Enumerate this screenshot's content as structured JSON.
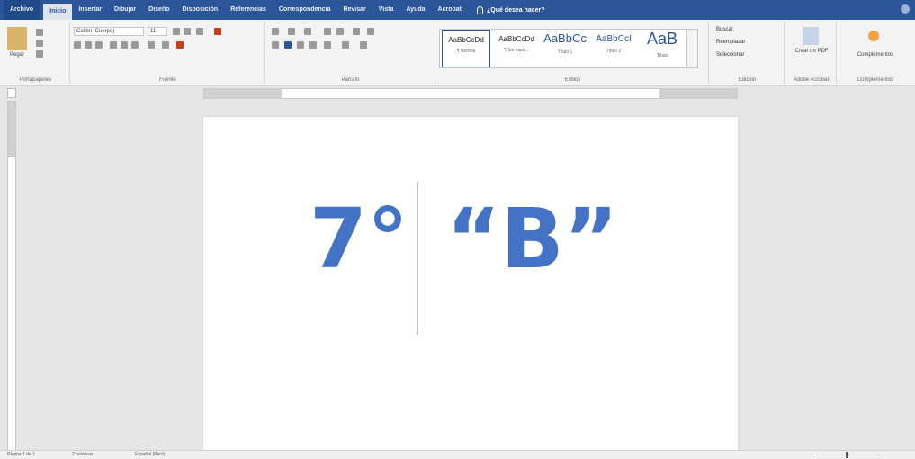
{
  "tabs": {
    "file": "Archivo",
    "items": [
      "Inicio",
      "Insertar",
      "Dibujar",
      "Diseño",
      "Disposición",
      "Referencias",
      "Correspondencia",
      "Revisar",
      "Vista",
      "Ayuda",
      "Acrobat"
    ],
    "active_index": 0,
    "tell_me": "¿Qué desea hacer?"
  },
  "ribbon": {
    "clipboard": {
      "paste": "Pegar",
      "label": "Portapapeles"
    },
    "font": {
      "family": "Calibri (Cuerpo)",
      "size": "11",
      "label": "Fuente"
    },
    "paragraph": {
      "label": "Párrafo"
    },
    "styles": {
      "label": "Estilos",
      "items": [
        {
          "sample": "AaBbCcDd",
          "name": "¶ Normal"
        },
        {
          "sample": "AaBbCcDd",
          "name": "¶ Sin espa..."
        },
        {
          "sample": "AaBbCc",
          "name": "Título 1"
        },
        {
          "sample": "AaBbCcI",
          "name": "Título 2"
        },
        {
          "sample": "AaB",
          "name": "Título"
        }
      ]
    },
    "editing": {
      "find": "Buscar",
      "replace": "Reemplazar",
      "select": "Seleccionar",
      "label": "Edición"
    },
    "acrobat": {
      "create": "Crear un PDF",
      "label": "Adobe Acrobat"
    },
    "addins": {
      "button": "Complementos",
      "label": "Complementos"
    }
  },
  "document": {
    "grade": "7°",
    "section": "“B”"
  },
  "statusbar": {
    "page": "Página 1 de 1",
    "words": "2 palabras",
    "language": "Español (Perú)"
  },
  "colors": {
    "accent": "#2b579a",
    "text": "#4472c4"
  }
}
